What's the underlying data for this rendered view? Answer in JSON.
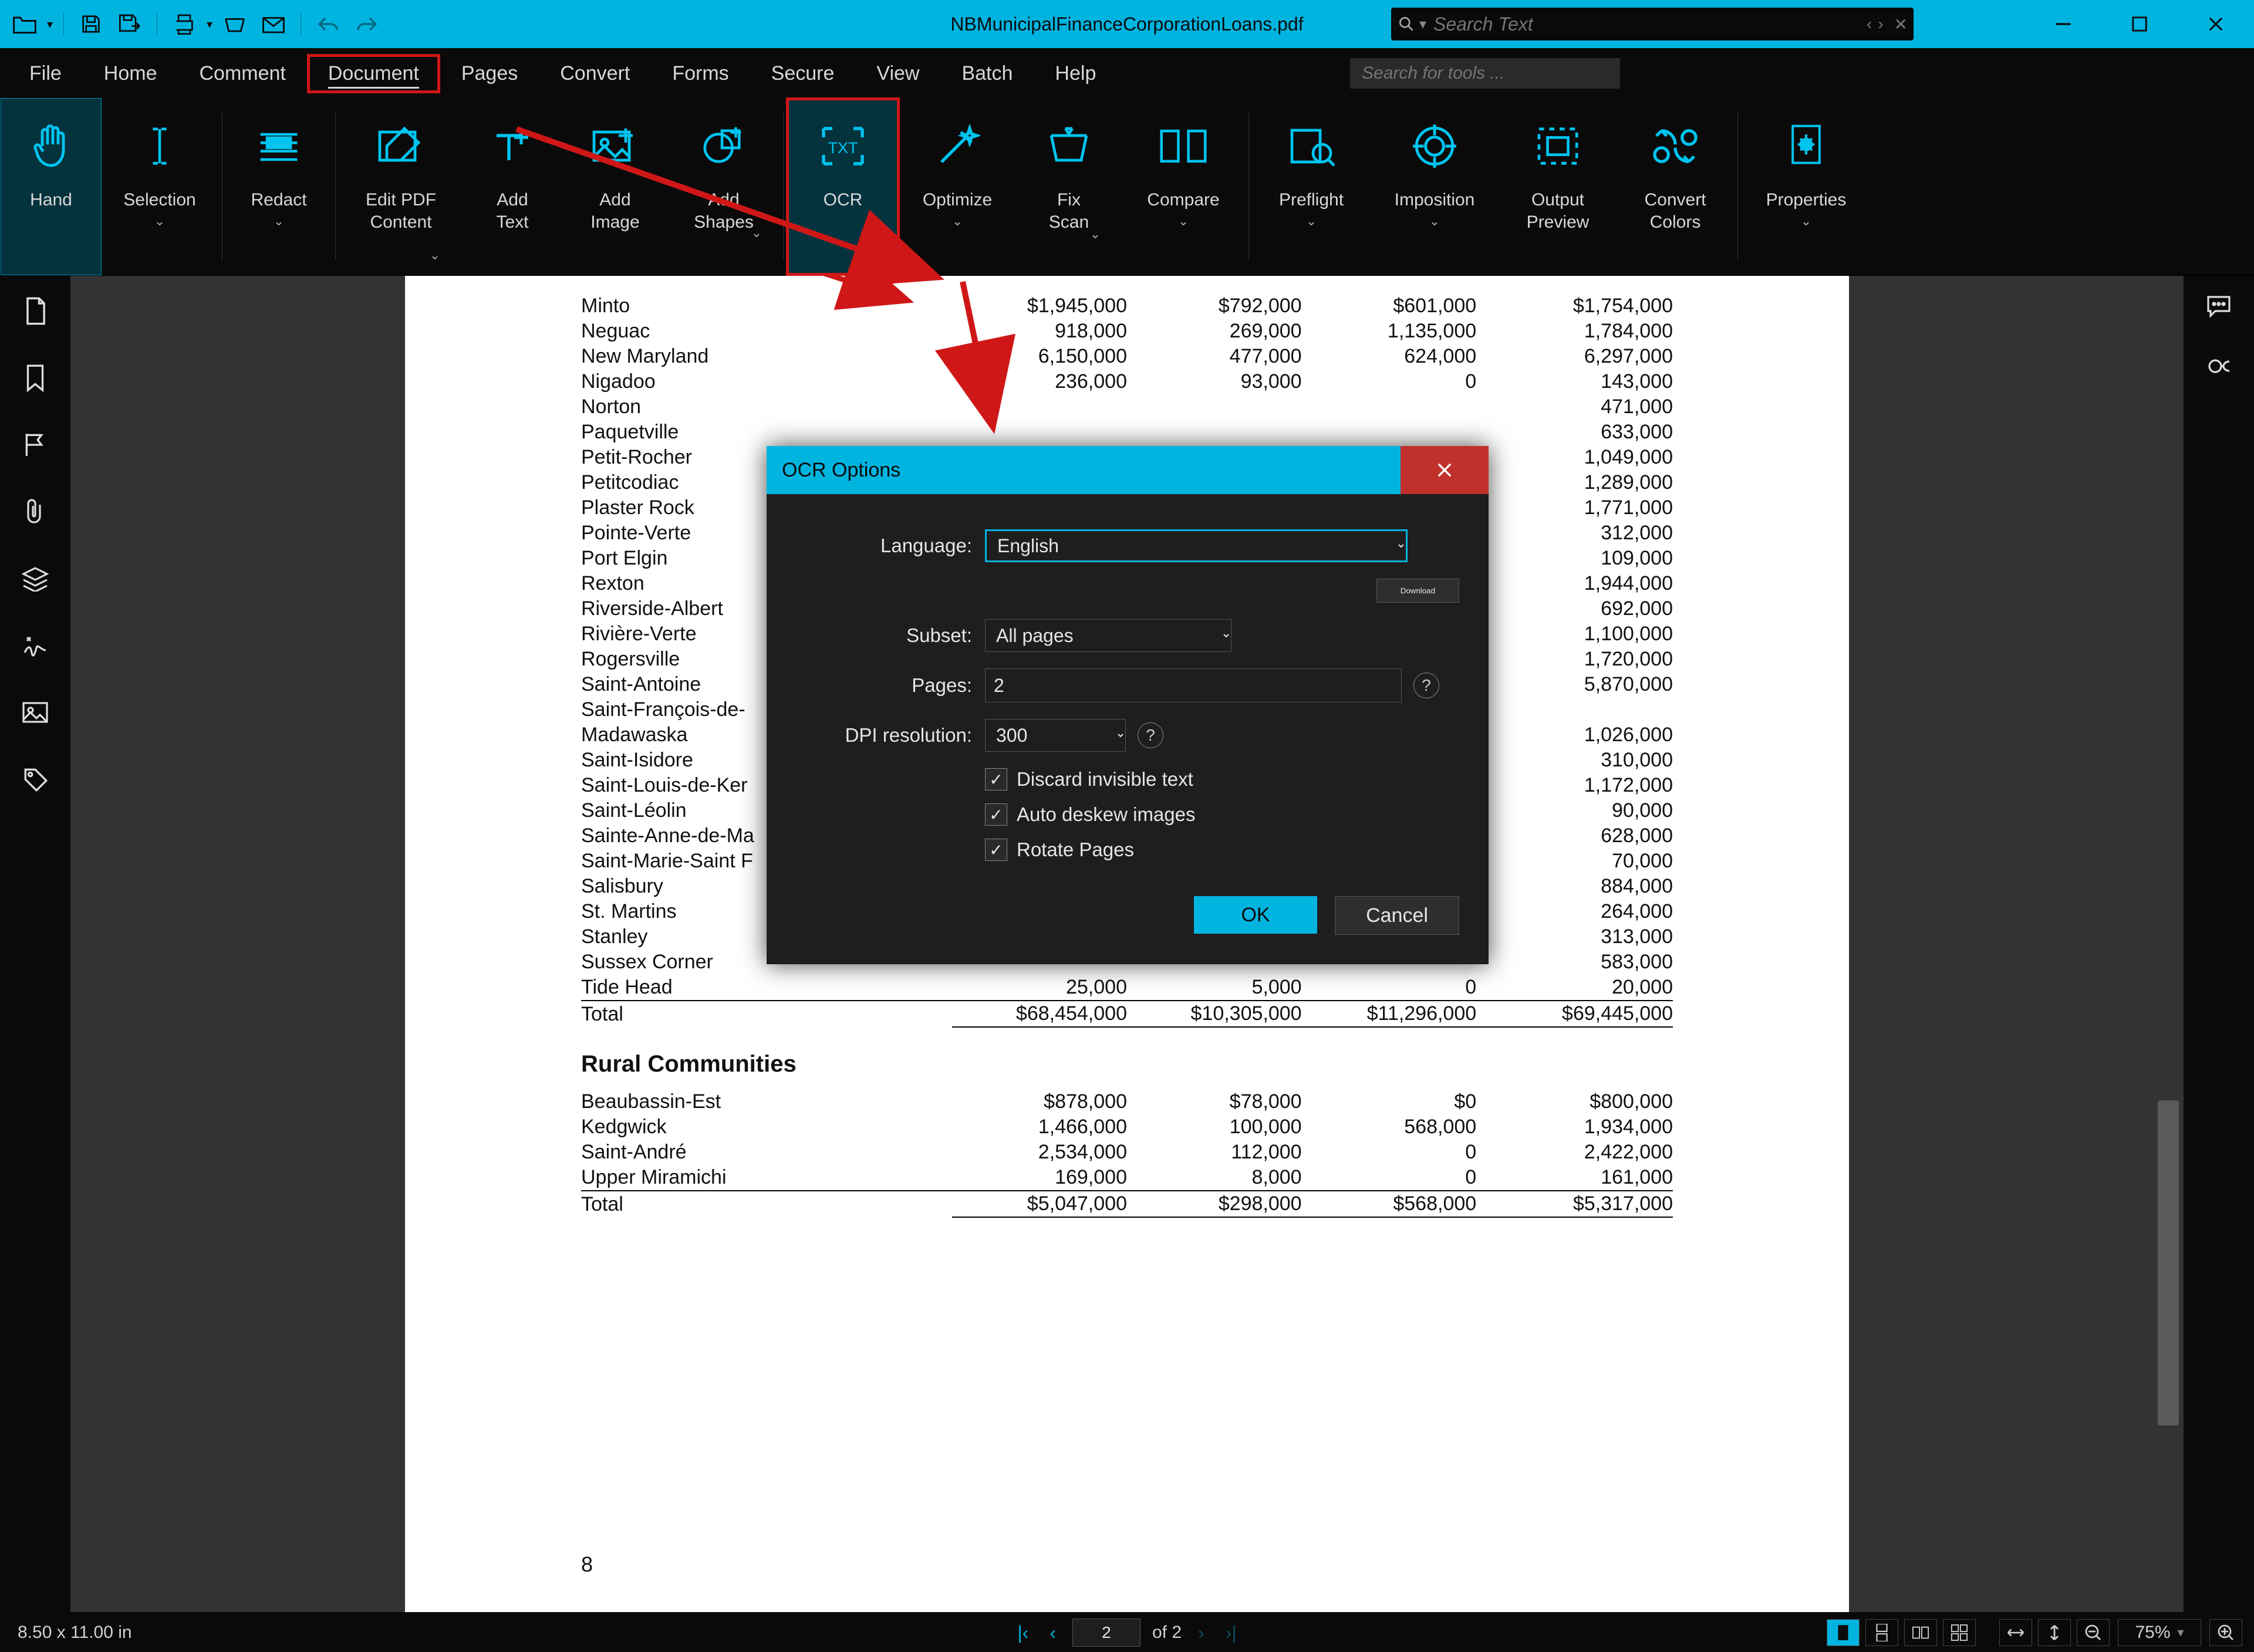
{
  "title": "NBMunicipalFinanceCorporationLoans.pdf",
  "search_placeholder": "Search Text",
  "tool_search_placeholder": "Search for tools ...",
  "menus": [
    "File",
    "Home",
    "Comment",
    "Document",
    "Pages",
    "Convert",
    "Forms",
    "Secure",
    "View",
    "Batch",
    "Help"
  ],
  "ribbon": {
    "hand": "Hand",
    "selection": "Selection",
    "redact": "Redact",
    "edit_pdf": "Edit PDF\nContent",
    "add_text": "Add\nText",
    "add_image": "Add\nImage",
    "add_shapes": "Add\nShapes",
    "ocr": "OCR",
    "optimize": "Optimize",
    "fix_scan": "Fix\nScan",
    "compare": "Compare",
    "preflight": "Preflight",
    "imposition": "Imposition",
    "output_preview": "Output\nPreview",
    "convert_colors": "Convert\nColors",
    "properties": "Properties"
  },
  "doc": {
    "rows1": [
      [
        "Minto",
        "$1,945,000",
        "$792,000",
        "$601,000",
        "$1,754,000"
      ],
      [
        "Neguac",
        "918,000",
        "269,000",
        "1,135,000",
        "1,784,000"
      ],
      [
        "New Maryland",
        "6,150,000",
        "477,000",
        "624,000",
        "6,297,000"
      ],
      [
        "Nigadoo",
        "236,000",
        "93,000",
        "0",
        "143,000"
      ],
      [
        "Norton",
        "",
        "",
        "",
        "471,000"
      ],
      [
        "Paquetville",
        "",
        "",
        "",
        "633,000"
      ],
      [
        "Petit-Rocher",
        "",
        "",
        "",
        "1,049,000"
      ],
      [
        "Petitcodiac",
        "",
        "",
        "",
        "1,289,000"
      ],
      [
        "Plaster Rock",
        "",
        "",
        "",
        "1,771,000"
      ],
      [
        "Pointe-Verte",
        "",
        "",
        "",
        "312,000"
      ],
      [
        "Port Elgin",
        "",
        "",
        "",
        "109,000"
      ],
      [
        "Rexton",
        "",
        "",
        "",
        "1,944,000"
      ],
      [
        "Riverside-Albert",
        "",
        "",
        "",
        "692,000"
      ],
      [
        "Rivière-Verte",
        "",
        "",
        "",
        "1,100,000"
      ],
      [
        "Rogersville",
        "",
        "",
        "",
        "1,720,000"
      ],
      [
        "Saint-Antoine",
        "",
        "",
        "",
        "5,870,000"
      ],
      [
        "Saint-François-de-",
        "",
        "",
        "",
        ""
      ],
      [
        "Madawaska",
        "",
        "",
        "",
        "1,026,000"
      ],
      [
        "Saint-Isidore",
        "",
        "",
        "",
        "310,000"
      ],
      [
        "Saint-Louis-de-Ker",
        "",
        "",
        "",
        "1,172,000"
      ],
      [
        "Saint-Léolin",
        "",
        "",
        "",
        "90,000"
      ],
      [
        "Sainte-Anne-de-Ma",
        "",
        "",
        "",
        "628,000"
      ],
      [
        "Saint-Marie-Saint F",
        "",
        "",
        "",
        "70,000"
      ],
      [
        "Salisbury",
        "",
        "",
        "",
        "884,000"
      ],
      [
        "St. Martins",
        "",
        "",
        "",
        "264,000"
      ],
      [
        "Stanley",
        "",
        "",
        "",
        "313,000"
      ],
      [
        "Sussex Corner",
        "",
        "",
        "",
        "583,000"
      ],
      [
        "Tide Head",
        "25,000",
        "5,000",
        "0",
        "20,000"
      ]
    ],
    "total1": [
      "Total",
      "$68,454,000",
      "$10,305,000",
      "$11,296,000",
      "$69,445,000"
    ],
    "section2": "Rural Communities",
    "rows2": [
      [
        "Beaubassin-Est",
        "$878,000",
        "$78,000",
        "$0",
        "$800,000"
      ],
      [
        "Kedgwick",
        "1,466,000",
        "100,000",
        "568,000",
        "1,934,000"
      ],
      [
        "Saint-André",
        "2,534,000",
        "112,000",
        "0",
        "2,422,000"
      ],
      [
        "Upper Miramichi",
        "169,000",
        "8,000",
        "0",
        "161,000"
      ]
    ],
    "total2": [
      "Total",
      "$5,047,000",
      "$298,000",
      "$568,000",
      "$5,317,000"
    ],
    "page_number": "8"
  },
  "dialog": {
    "title": "OCR Options",
    "language_label": "Language:",
    "language_value": "English",
    "download": "Download",
    "subset_label": "Subset:",
    "subset_value": "All pages",
    "pages_label": "Pages:",
    "pages_value": "2",
    "dpi_label": "DPI resolution:",
    "dpi_value": "300",
    "discard": "Discard invisible text",
    "deskew": "Auto deskew images",
    "rotate": "Rotate Pages",
    "ok": "OK",
    "cancel": "Cancel"
  },
  "status": {
    "dims": "8.50 x 11.00 in",
    "page": "2",
    "of": "of 2",
    "zoom": "75%"
  }
}
